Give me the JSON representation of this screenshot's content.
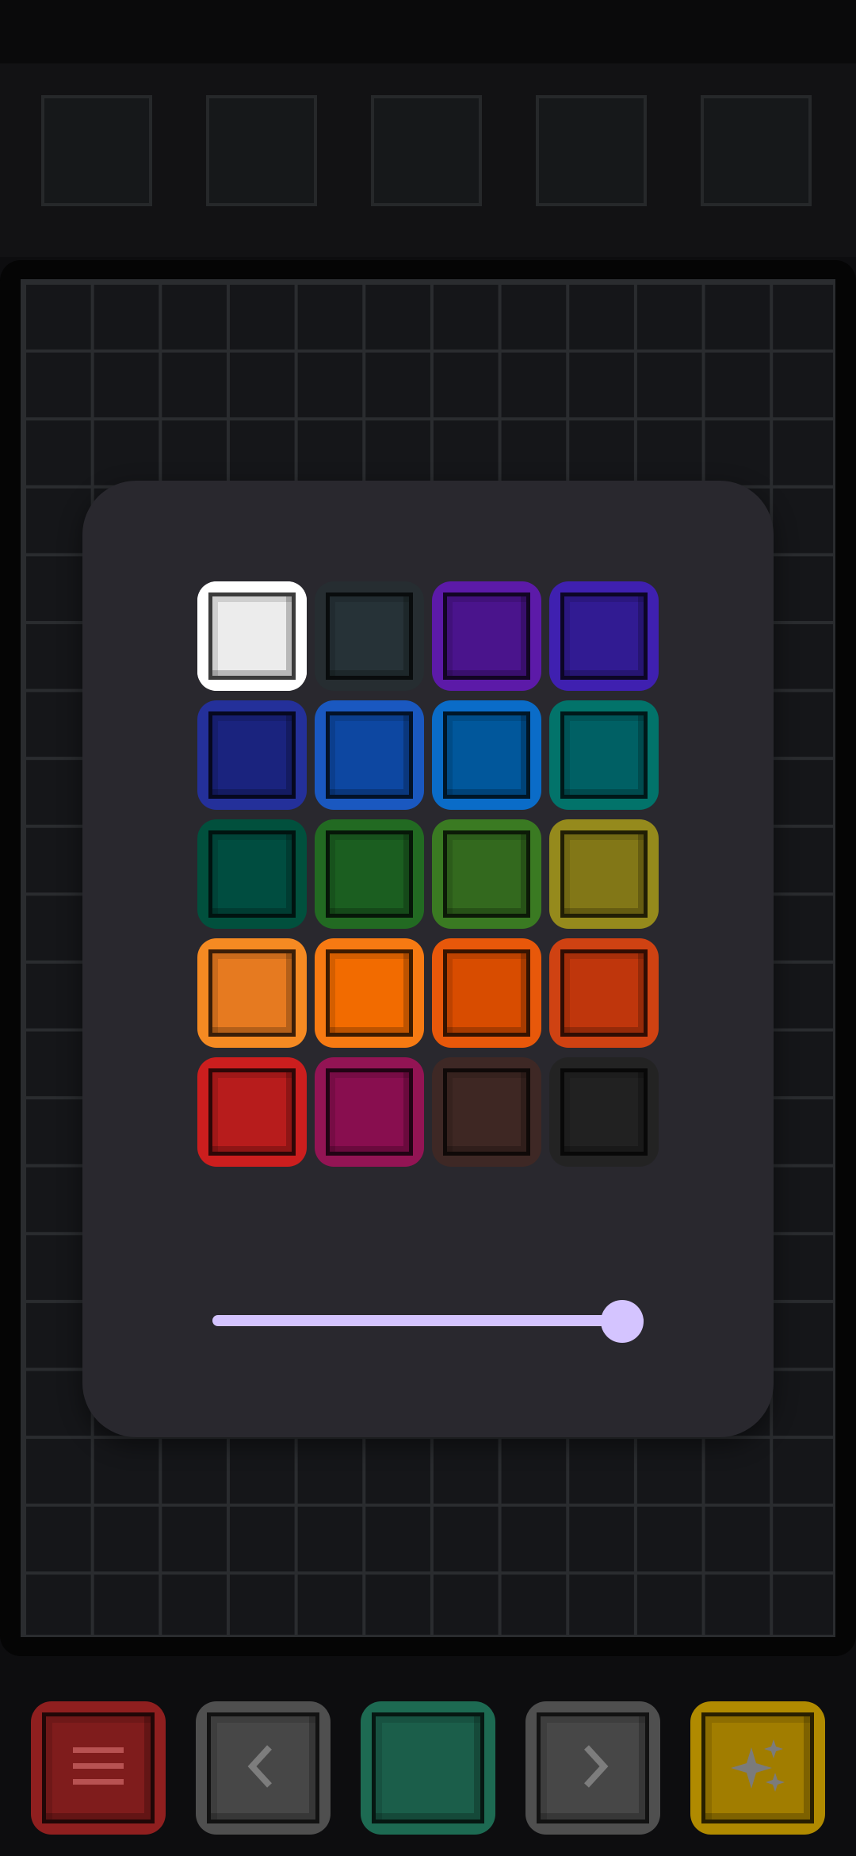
{
  "colors": {
    "app_background": "#0d0d0f",
    "board_background": "#151619",
    "grid_line": "#2a2c2f",
    "panel_background": "#29282e",
    "slider_accent": "#d4c4ff",
    "selected_outline": "#ffffff"
  },
  "palette": {
    "selected_index": 0,
    "swatches": [
      {
        "name": "white",
        "outer": "#ffffff",
        "inner": "#ececec"
      },
      {
        "name": "slate",
        "outer": "#262d31",
        "inner": "#263237"
      },
      {
        "name": "deep-purple",
        "outer": "#5c1aa8",
        "inner": "#4a148c"
      },
      {
        "name": "indigo",
        "outer": "#3f20b0",
        "inner": "#311b92"
      },
      {
        "name": "navy",
        "outer": "#24309a",
        "inner": "#1a237e"
      },
      {
        "name": "blue",
        "outer": "#1a58c0",
        "inner": "#0d47a1"
      },
      {
        "name": "light-blue",
        "outer": "#0a6cc8",
        "inner": "#01579b"
      },
      {
        "name": "teal",
        "outer": "#02736a",
        "inner": "#006064"
      },
      {
        "name": "dark-green",
        "outer": "#01503d",
        "inner": "#004d40"
      },
      {
        "name": "green",
        "outer": "#226a22",
        "inner": "#1b5e20"
      },
      {
        "name": "olive-green",
        "outer": "#3a7a22",
        "inner": "#33691e"
      },
      {
        "name": "olive",
        "outer": "#958a1c",
        "inner": "#827717"
      },
      {
        "name": "amber-orange",
        "outer": "#f58a22",
        "inner": "#e67a20"
      },
      {
        "name": "orange",
        "outer": "#f77a12",
        "inner": "#f26b00"
      },
      {
        "name": "deep-orange",
        "outer": "#e8580a",
        "inner": "#d84c00"
      },
      {
        "name": "rust",
        "outer": "#cf4212",
        "inner": "#bf360c"
      },
      {
        "name": "red",
        "outer": "#cc1e1e",
        "inner": "#b71c1c"
      },
      {
        "name": "magenta",
        "outer": "#931454",
        "inner": "#880e4f"
      },
      {
        "name": "brown",
        "outer": "#3e2825",
        "inner": "#3e2723"
      },
      {
        "name": "charcoal",
        "outer": "#232323",
        "inner": "#212121"
      }
    ]
  },
  "slider": {
    "value_percent": 95,
    "track_color": "#d4c4ff",
    "thumb_color": "#d4c4ff"
  },
  "toolbar": {
    "buttons": [
      {
        "name": "menu-button",
        "icon": "menu-icon",
        "outer": "#8f1f1f",
        "inner": "#7f1c1c",
        "icon_color": "#b85252"
      },
      {
        "name": "previous-button",
        "icon": "chevron-left-icon",
        "outer": "#4f4f4f",
        "inner": "#474747",
        "icon_color": "#7d7d7d"
      },
      {
        "name": "current-color-button",
        "icon": "",
        "outer": "#1d6a52",
        "inner": "#1b5e4a",
        "icon_color": ""
      },
      {
        "name": "next-button",
        "icon": "chevron-right-icon",
        "outer": "#4f4f4f",
        "inner": "#474747",
        "icon_color": "#7d7d7d"
      },
      {
        "name": "magic-button",
        "icon": "sparkles-icon",
        "outer": "#b08a00",
        "inner": "#a17d00",
        "icon_color": "#7b7b7b"
      }
    ]
  }
}
